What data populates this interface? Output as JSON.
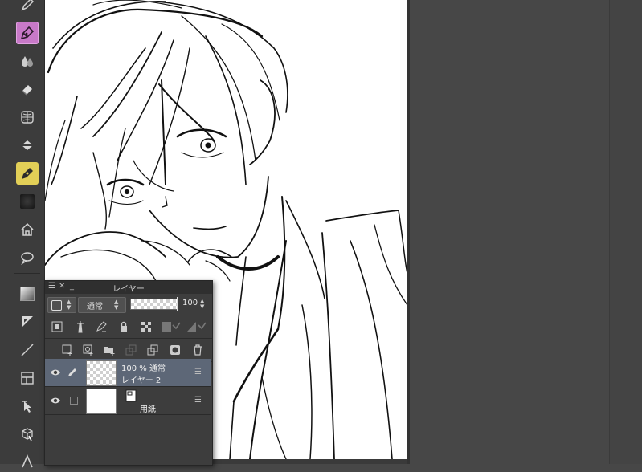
{
  "colors": {
    "active_tool": "#c879c8",
    "marker_tool": "#e2cf57",
    "selected_layer": "#5d6777",
    "workspace": "#474747"
  },
  "toolbar": {
    "tools": [
      {
        "name": "pen-icon",
        "state": "normal"
      },
      {
        "name": "g-pen-icon",
        "state": "active"
      },
      {
        "name": "watercolor-icon",
        "state": "normal"
      },
      {
        "name": "eraser-icon",
        "state": "normal"
      },
      {
        "name": "sphere-grid-icon",
        "state": "normal"
      },
      {
        "name": "fill-bucket-icon",
        "state": "normal"
      },
      {
        "name": "marker-icon",
        "state": "highlight"
      },
      {
        "name": "gradient-swatch-icon",
        "state": "normal"
      },
      {
        "name": "home-icon",
        "state": "normal"
      },
      {
        "name": "speech-bubble-icon",
        "state": "normal"
      },
      {
        "name": "gradient-square-icon",
        "state": "normal"
      },
      {
        "name": "ruler-icon",
        "state": "normal"
      },
      {
        "name": "line-icon",
        "state": "normal"
      },
      {
        "name": "frame-icon",
        "state": "normal"
      },
      {
        "name": "select-arrow-icon",
        "state": "normal"
      },
      {
        "name": "3d-object-icon",
        "state": "normal"
      },
      {
        "name": "text-icon",
        "state": "normal"
      }
    ]
  },
  "layer_panel": {
    "title": "レイヤー",
    "blend_mode": "通常",
    "opacity": "100",
    "opacity_fraction": 1.0,
    "layers": [
      {
        "line1": "100 % 通常",
        "line2": "レイヤー 2",
        "selected": true,
        "visible": true
      },
      {
        "line1": "",
        "line2": "用紙",
        "selected": false,
        "visible": true
      }
    ]
  }
}
